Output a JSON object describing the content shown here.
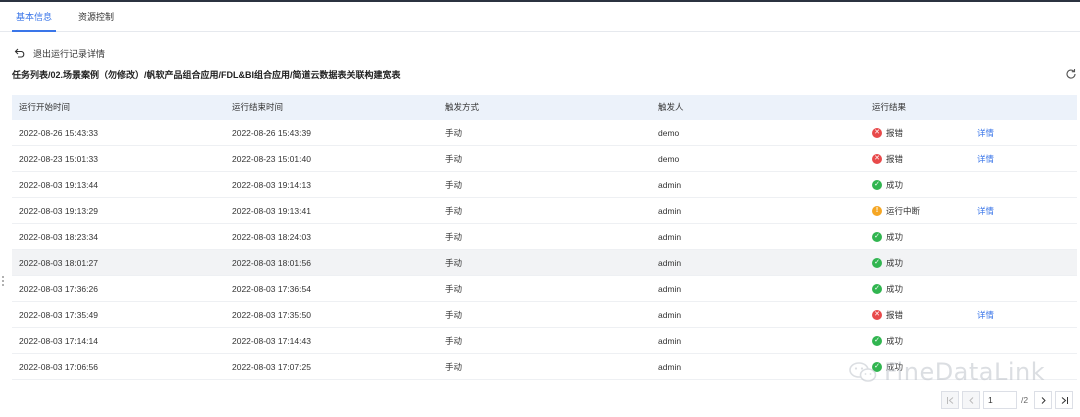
{
  "tabs": [
    {
      "label": "基本信息",
      "active": true
    },
    {
      "label": "资源控制",
      "active": false
    }
  ],
  "back_label": "退出运行记录详情",
  "path": "任务列表/02.场景案例（勿修改）/帆软产品组合应用/FDL&BI组合应用/简道云数据表关联构建宽表",
  "columns": [
    "运行开始时间",
    "运行结束时间",
    "触发方式",
    "触发人",
    "运行结果"
  ],
  "rows": [
    {
      "start": "2022-08-26 15:43:33",
      "end": "2022-08-26 15:43:39",
      "trigger": "手动",
      "user": "demo",
      "result": "报错",
      "status": "error",
      "detail": "详情"
    },
    {
      "start": "2022-08-23 15:01:33",
      "end": "2022-08-23 15:01:40",
      "trigger": "手动",
      "user": "demo",
      "result": "报错",
      "status": "error",
      "detail": "详情"
    },
    {
      "start": "2022-08-03 19:13:44",
      "end": "2022-08-03 19:14:13",
      "trigger": "手动",
      "user": "admin",
      "result": "成功",
      "status": "success",
      "detail": ""
    },
    {
      "start": "2022-08-03 19:13:29",
      "end": "2022-08-03 19:13:41",
      "trigger": "手动",
      "user": "admin",
      "result": "运行中断",
      "status": "warn",
      "detail": "详情"
    },
    {
      "start": "2022-08-03 18:23:34",
      "end": "2022-08-03 18:24:03",
      "trigger": "手动",
      "user": "admin",
      "result": "成功",
      "status": "success",
      "detail": ""
    },
    {
      "start": "2022-08-03 18:01:27",
      "end": "2022-08-03 18:01:56",
      "trigger": "手动",
      "user": "admin",
      "result": "成功",
      "status": "success",
      "detail": ""
    },
    {
      "start": "2022-08-03 17:36:26",
      "end": "2022-08-03 17:36:54",
      "trigger": "手动",
      "user": "admin",
      "result": "成功",
      "status": "success",
      "detail": ""
    },
    {
      "start": "2022-08-03 17:35:49",
      "end": "2022-08-03 17:35:50",
      "trigger": "手动",
      "user": "admin",
      "result": "报错",
      "status": "error",
      "detail": "详情"
    },
    {
      "start": "2022-08-03 17:14:14",
      "end": "2022-08-03 17:14:43",
      "trigger": "手动",
      "user": "admin",
      "result": "成功",
      "status": "success",
      "detail": ""
    },
    {
      "start": "2022-08-03 17:06:56",
      "end": "2022-08-03 17:07:25",
      "trigger": "手动",
      "user": "admin",
      "result": "成功",
      "status": "success",
      "detail": ""
    }
  ],
  "highlighted_row": 5,
  "pagination": {
    "current": "1",
    "total": "/2"
  },
  "watermark": "FineDataLink",
  "colors": {
    "accent": "#3a76e9",
    "error": "#e8494a",
    "success": "#31b550",
    "warn": "#f5a623",
    "header_bg": "#ecf2fa"
  },
  "icons": {
    "back": "back-arrow-icon",
    "refresh": "refresh-icon",
    "watermark": "wechat-icon"
  }
}
